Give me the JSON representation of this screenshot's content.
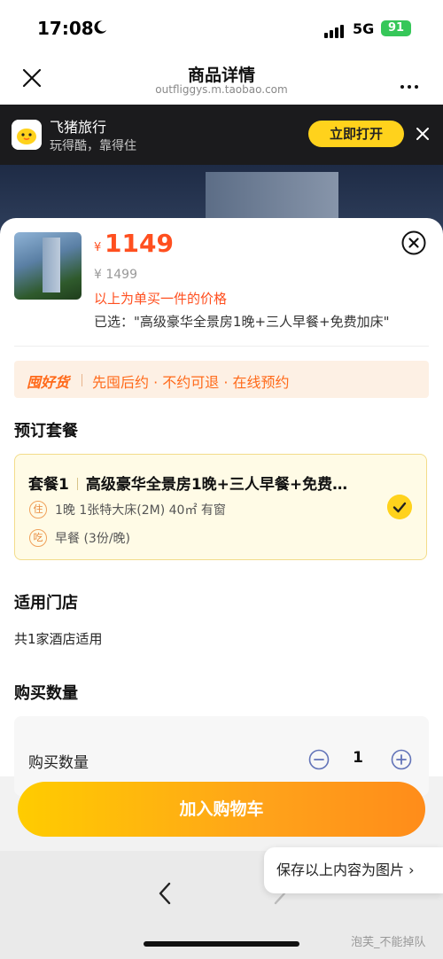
{
  "status": {
    "time": "17:08",
    "network": "5G",
    "battery": "91"
  },
  "browser": {
    "title": "商品详情",
    "url": "outfliggys.m.taobao.com"
  },
  "banner": {
    "app_name": "飞猪旅行",
    "slogan": "玩得酷，靠得住",
    "open_label": "立即打开"
  },
  "product": {
    "currency_symbol": "¥",
    "price": "1149",
    "original_price": "¥ 1499",
    "price_note": "以上为单买一件的价格",
    "selected": "已选：\"高级豪华全景房1晚+三人早餐+免费加床\""
  },
  "guarantee": {
    "tag": "囤好货",
    "text": "先囤后约 · 不约可退 · 在线预约"
  },
  "package_section": {
    "title": "预订套餐",
    "item": {
      "label": "套餐1",
      "name": "高级豪华全景房1晚+三人早餐+免费…",
      "stay_badge": "住",
      "stay_detail": "1晚 1张特大床(2M) 40㎡ 有窗",
      "meal_badge": "吃",
      "meal_detail": "早餐 (3份/晚)"
    }
  },
  "store_section": {
    "title": "适用门店",
    "count_text": "共1家酒店适用"
  },
  "quantity_section": {
    "title": "购买数量",
    "label": "购买数量",
    "value": "1"
  },
  "actions": {
    "add_to_cart": "加入购物车",
    "save_as_image": "保存以上内容为图片 ›"
  },
  "watermark": "泡芙_不能掉队",
  "colors": {
    "accent_orange": "#ff4f1f",
    "brand_yellow": "#ffd21c"
  }
}
